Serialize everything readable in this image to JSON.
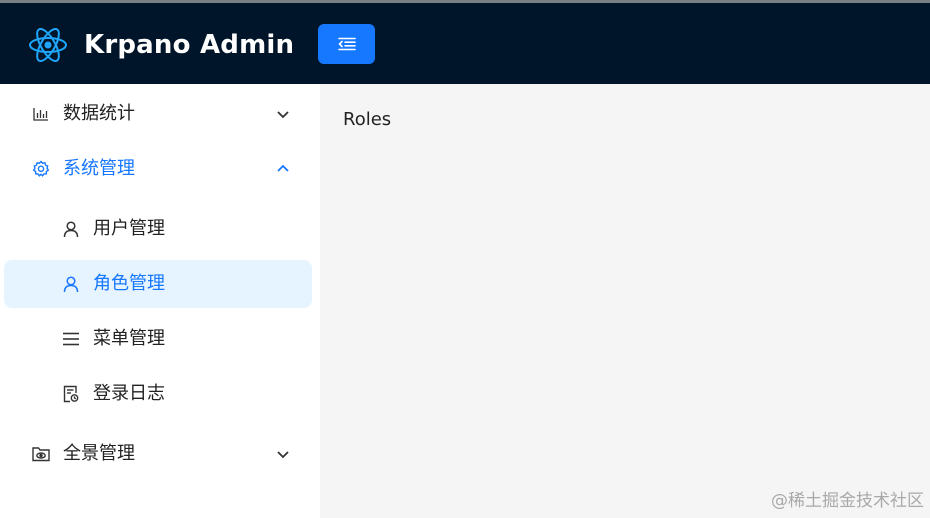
{
  "header": {
    "brand": "Krpano Admin",
    "logo_icon": "react-logo-icon",
    "toggle_icon": "menu-fold-icon",
    "accent": "#1677ff",
    "background": "#001529"
  },
  "sidebar": {
    "items": [
      {
        "label": "数据统计",
        "icon": "bar-chart-icon",
        "arrow": "chevron-down-icon",
        "state": "collapsed"
      },
      {
        "label": "系统管理",
        "icon": "gear-icon",
        "arrow": "chevron-up-icon",
        "state": "expanded"
      },
      {
        "label": "用户管理",
        "icon": "user-icon",
        "state": "normal"
      },
      {
        "label": "角色管理",
        "icon": "user-icon",
        "state": "selected"
      },
      {
        "label": "菜单管理",
        "icon": "list-icon",
        "state": "normal"
      },
      {
        "label": "登录日志",
        "icon": "log-file-icon",
        "state": "normal"
      },
      {
        "label": "全景管理",
        "icon": "folder-eye-icon",
        "arrow": "chevron-down-icon",
        "state": "collapsed"
      }
    ]
  },
  "main": {
    "content": "Roles"
  },
  "watermark": "@稀土掘金技术社区"
}
